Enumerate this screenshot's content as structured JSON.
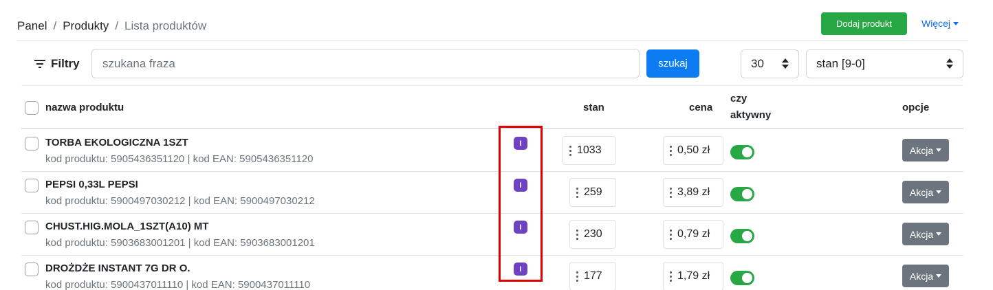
{
  "breadcrumb": {
    "items": [
      "Panel",
      "Produkty",
      "Lista produktów"
    ],
    "separator": "/"
  },
  "header": {
    "add_button": "Dodaj produkt",
    "more_label": "Więcej"
  },
  "filters": {
    "label": "Filtry",
    "search_placeholder": "szukana fraza",
    "search_button": "szukaj",
    "per_page": "30",
    "sort": "stan [9-0]"
  },
  "table": {
    "headers": {
      "name": "nazwa produktu",
      "stock": "stan",
      "price": "cena",
      "active_line1": "czy",
      "active_line2": "aktywny",
      "options": "opcje"
    },
    "rows": [
      {
        "name": "TORBA EKOLOGICZNA 1SZT",
        "codes": "kod produktu: 5905436351120 | kod EAN: 5905436351120",
        "badge": "I",
        "stock": "1033",
        "price": "0,50 zł",
        "active": true,
        "action": "Akcja"
      },
      {
        "name": "PEPSI 0,33L PEPSI",
        "codes": "kod produktu: 5900497030212 | kod EAN: 5900497030212",
        "badge": "I",
        "stock": "259",
        "price": "3,89 zł",
        "active": true,
        "action": "Akcja"
      },
      {
        "name": "CHUST.HIG.MOLA_1SZT(A10) MT",
        "codes": "kod produktu: 5903683001201 | kod EAN: 5903683001201",
        "badge": "I",
        "stock": "230",
        "price": "0,79 zł",
        "active": true,
        "action": "Akcja"
      },
      {
        "name": "DROŻDŻE INSTANT 7G DR O.",
        "codes": "kod produktu: 5900437011110 | kod EAN: 5900437011110",
        "badge": "I",
        "stock": "177",
        "price": "1,79 zł",
        "active": true,
        "action": "Akcja"
      }
    ]
  },
  "colors": {
    "primary": "#0d7cf2",
    "success": "#28a745",
    "secondary": "#6c757d",
    "badge": "#6f42c1",
    "highlight": "#e00000"
  }
}
